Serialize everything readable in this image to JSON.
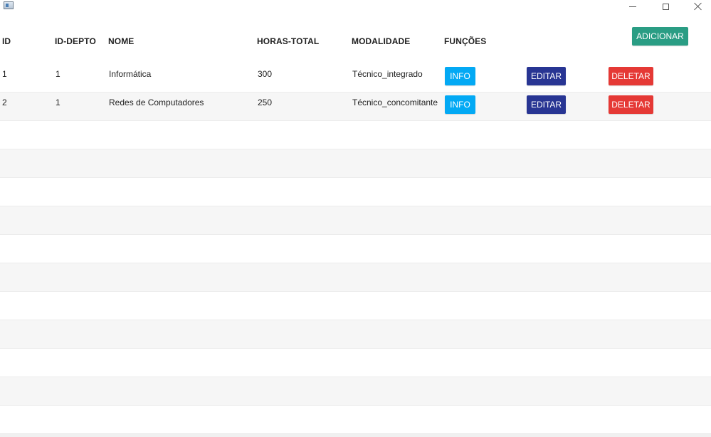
{
  "window": {
    "icon": "app-window-icon",
    "controls": {
      "minimize_icon": "minimize-icon",
      "maximize_icon": "maximize-icon",
      "close_icon": "close-icon"
    }
  },
  "table": {
    "columns": [
      "ID",
      "ID-DEPTO",
      "NOME",
      "HORAS-TOTAL",
      "MODALIDADE",
      "FUNÇÕES"
    ],
    "add_button": "ADICIONAR",
    "rows": [
      {
        "id": "1",
        "id_depto": "1",
        "nome": "Informática",
        "horas_total": "300",
        "modalidade": "Técnico_integrado",
        "info_label": "INFO",
        "edit_label": "EDITAR",
        "delete_label": "DELETAR"
      },
      {
        "id": "2",
        "id_depto": "1",
        "nome": "Redes de Computadores",
        "horas_total": "250",
        "modalidade": "Técnico_concomitante",
        "info_label": "INFO",
        "edit_label": "EDITAR",
        "delete_label": "DELETAR"
      }
    ],
    "empty_rows": 11
  },
  "colors": {
    "add": "#2a9d84",
    "info": "#03a9f4",
    "edit": "#283593",
    "delete": "#e53935",
    "row_alt": "#f6f6f6"
  }
}
